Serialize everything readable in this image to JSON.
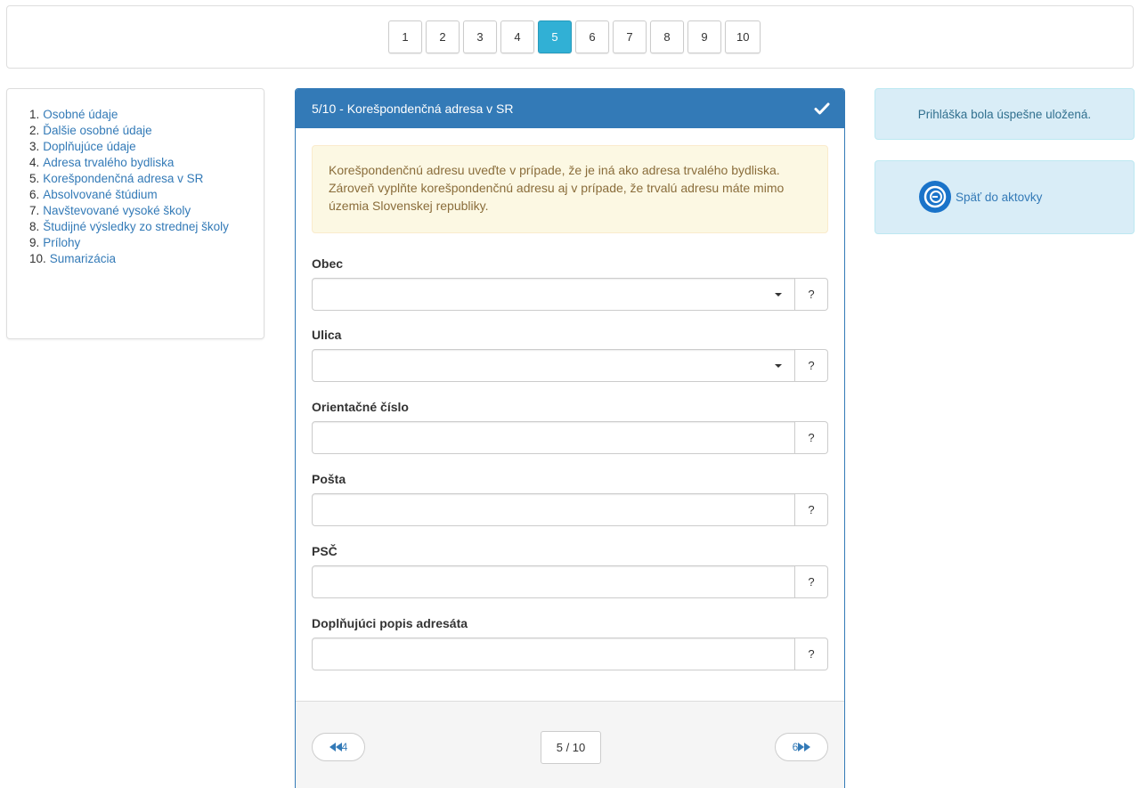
{
  "steps": [
    "1",
    "2",
    "3",
    "4",
    "5",
    "6",
    "7",
    "8",
    "9",
    "10"
  ],
  "active_step": "5",
  "nav": {
    "items": [
      {
        "num": "1.",
        "label": "Osobné údaje"
      },
      {
        "num": "2.",
        "label": "Ďalšie osobné údaje"
      },
      {
        "num": "3.",
        "label": "Doplňujúce údaje"
      },
      {
        "num": "4.",
        "label": "Adresa trvalého bydliska"
      },
      {
        "num": "5.",
        "label": "Korešpondenčná adresa v SR"
      },
      {
        "num": "6.",
        "label": "Absolvované štúdium"
      },
      {
        "num": "7.",
        "label": "Navštevované vysoké školy"
      },
      {
        "num": "8.",
        "label": "Študijné výsledky zo strednej školy"
      },
      {
        "num": "9.",
        "label": "Prílohy"
      },
      {
        "num": "10.",
        "label": "Sumarizácia"
      }
    ]
  },
  "panel": {
    "title": "5/10 - Korešpondenčná adresa v SR",
    "info": "Korešpondenčnú adresu uveďte v prípade, že je iná ako adresa trvalého bydliska. Zároveň vyplňte korešpondenčnú adresu aj v prípade, že trvalú adresu máte mimo územia Slovenskej republiky.",
    "fields": {
      "obec": {
        "label": "Obec",
        "value": ""
      },
      "ulica": {
        "label": "Ulica",
        "value": ""
      },
      "orientacne": {
        "label": "Orientačné číslo",
        "value": ""
      },
      "posta": {
        "label": "Pošta",
        "value": ""
      },
      "psc": {
        "label": "PSČ",
        "value": ""
      },
      "popis": {
        "label": "Doplňujúci popis adresáta",
        "value": ""
      }
    },
    "help_label": "?",
    "footer": {
      "prev_label": "4",
      "next_label": "6",
      "page_indicator": "5 / 10"
    }
  },
  "sidebar_right": {
    "success_text": "Prihláška bola úspešne uložená.",
    "back_label": "Späť do aktovky"
  },
  "colors": {
    "primary": "#337ab7",
    "active_step": "#31b0d5",
    "info_bg": "#d9edf7",
    "warning_bg": "#fcf8e3"
  }
}
